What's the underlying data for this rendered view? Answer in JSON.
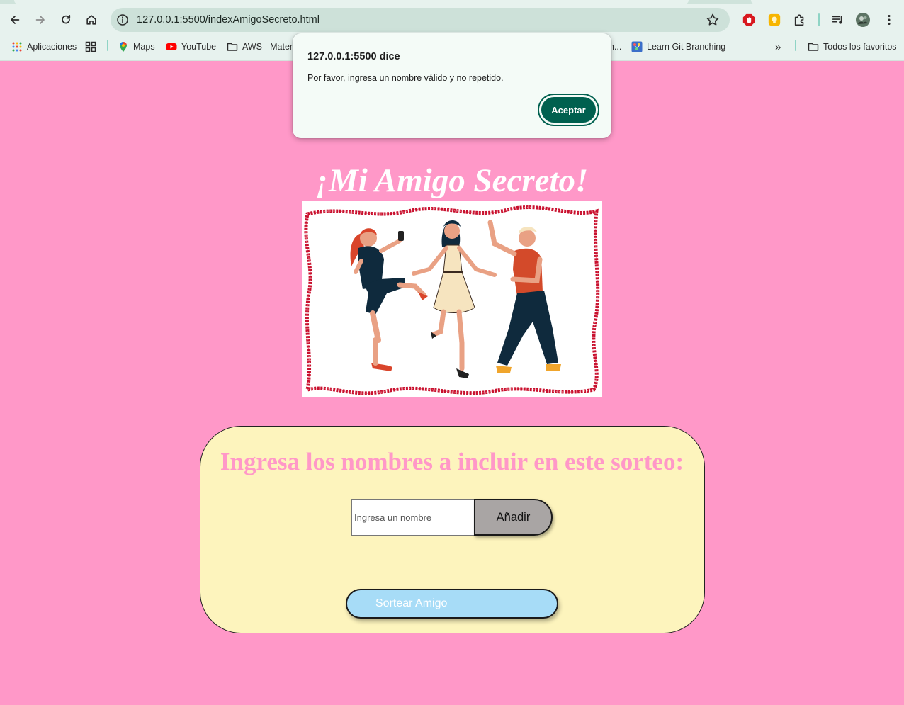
{
  "browser": {
    "url": "127.0.0.1:5500/indexAmigoSecreto.html",
    "icons": {
      "back": "back-arrow-icon",
      "forward": "forward-arrow-icon",
      "reload": "reload-icon",
      "home": "home-icon",
      "site_info": "site-info-icon",
      "bookmark_star": "bookmark-star-icon",
      "extensions": [
        "adblock-extension-icon",
        "yellow-extension-icon",
        "extensions-puzzle-icon",
        "media-controls-icon",
        "profile-avatar-icon",
        "kebab-menu-icon"
      ]
    },
    "bookmarks": [
      {
        "label": "Aplicaciones",
        "icon": "apps-grid-icon"
      },
      {
        "label": "Maps",
        "icon": "maps-pin-icon"
      },
      {
        "label": "YouTube",
        "icon": "youtube-icon"
      },
      {
        "label": "AWS - Mater",
        "icon": "folder-icon"
      },
      {
        "label": "n...",
        "icon": ""
      },
      {
        "label": "Learn Git Branching",
        "icon": "git-branching-icon"
      }
    ],
    "bookmarks_overflow": "»",
    "all_bookmarks": "Todos los favoritos"
  },
  "dialog": {
    "title": "127.0.0.1:5500 dice",
    "message": "Por favor, ingresa un nombre válido y no repetido.",
    "accept_label": "Aceptar"
  },
  "page": {
    "title": "¡Mi Amigo Secreto!",
    "illustration": "three-friends-dancing-illustration",
    "panel_title": "Ingresa los nombres a incluir en este sorteo:",
    "name_input": {
      "placeholder": "Ingresa un nombre",
      "value": ""
    },
    "add_label": "Añadir",
    "draw_label": "Sortear Amigo"
  },
  "colors": {
    "background": "#ff98c8",
    "panel": "#fdf4bd",
    "title_text": "#ffffff",
    "panel_title_text": "#ff98c8",
    "draw_button": "#a7dcf7",
    "add_button": "#a9a5a4",
    "dialog_accent": "#00604f"
  }
}
